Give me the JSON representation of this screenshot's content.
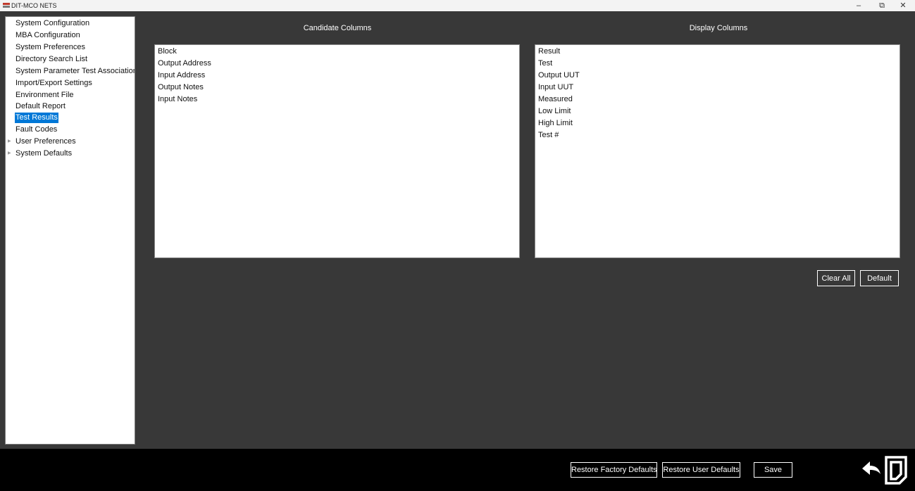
{
  "window": {
    "title": "DIT-MCO NETS",
    "minimize": "–",
    "maximize": "⧉",
    "close": "✕"
  },
  "sidebar": {
    "items": [
      {
        "label": "System Configuration"
      },
      {
        "label": "MBA Configuration"
      },
      {
        "label": "System Preferences"
      },
      {
        "label": "Directory Search List"
      },
      {
        "label": "System Parameter Test Associations"
      },
      {
        "label": "Import/Export Settings"
      },
      {
        "label": "Environment File"
      },
      {
        "label": "Default Report"
      },
      {
        "label": "Test Results",
        "selected": true
      },
      {
        "label": "Fault Codes"
      },
      {
        "label": "User Preferences",
        "expandable": true
      },
      {
        "label": "System Defaults",
        "expandable": true
      }
    ]
  },
  "candidate": {
    "title": "Candidate Columns",
    "items": [
      "Block",
      "Output Address",
      "Input Address",
      "Output Notes",
      "Input Notes"
    ]
  },
  "display": {
    "title": "Display Columns",
    "items": [
      "Result",
      "Test",
      "Output UUT",
      "Input UUT",
      "Measured",
      "Low Limit",
      "High Limit",
      "Test #"
    ]
  },
  "buttons": {
    "clear_all": "Clear All",
    "default": "Default",
    "restore_factory": "Restore Factory Defaults",
    "restore_user": "Restore User Defaults",
    "save": "Save"
  },
  "icons": {
    "back": "back-arrow-icon",
    "exit": "exit-door-icon"
  },
  "colors": {
    "background": "#383838",
    "selection": "#0078d7",
    "footer": "#000000"
  }
}
